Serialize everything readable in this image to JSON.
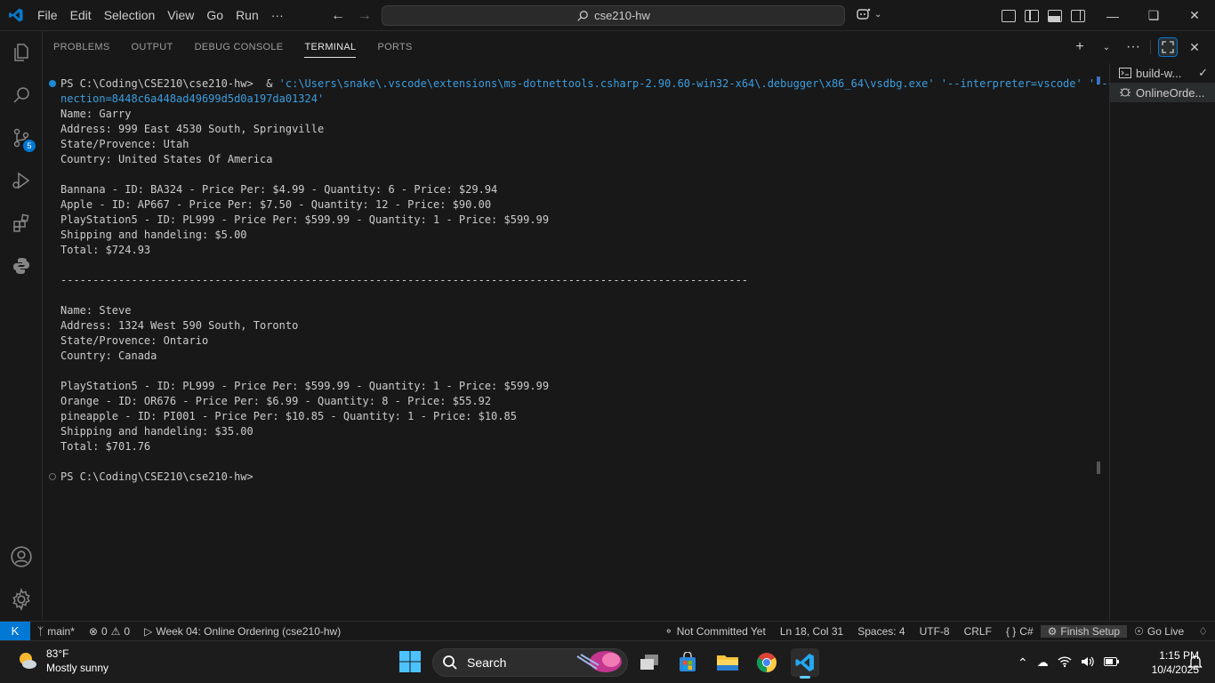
{
  "titlebar": {
    "menu": [
      "File",
      "Edit",
      "Selection",
      "View",
      "Go",
      "Run",
      "···"
    ],
    "search_text": "cse210-hw"
  },
  "panel": {
    "tabs": [
      "PROBLEMS",
      "OUTPUT",
      "DEBUG CONSOLE",
      "TERMINAL",
      "PORTS"
    ],
    "active_tab": "TERMINAL"
  },
  "terminal": {
    "command_prompt": "PS C:\\Coding\\CSE210\\cse210-hw>  & ",
    "command_string": "'c:\\Users\\snake\\.vscode\\extensions\\ms-dotnettools.csharp-2.90.60-win32-x64\\.debugger\\x86_64\\vsdbg.exe' '--interpreter=vscode' '--con",
    "command_wrap": "nection=8448c6a448ad49699d5d0a197da01324'",
    "lines": [
      "Name: Garry",
      "Address: 999 East 4530 South, Springville",
      "State/Provence: Utah",
      "Country: United States Of America",
      "",
      "Bannana - ID: BA324 - Price Per: $4.99 - Quantity: 6 - Price: $29.94",
      "Apple - ID: AP667 - Price Per: $7.50 - Quantity: 12 - Price: $90.00",
      "PlayStation5 - ID: PL999 - Price Per: $599.99 - Quantity: 1 - Price: $599.99",
      "Shipping and handeling: $5.00",
      "Total: $724.93",
      "",
      "-----------------------------------------------------------------------------------------------------------",
      "",
      "Name: Steve",
      "Address: 1324 West 590 South, Toronto",
      "State/Provence: Ontario",
      "Country: Canada",
      "",
      "PlayStation5 - ID: PL999 - Price Per: $599.99 - Quantity: 1 - Price: $599.99",
      "Orange - ID: OR676 - Price Per: $6.99 - Quantity: 8 - Price: $55.92",
      "pineapple - ID: PI001 - Price Per: $10.85 - Quantity: 1 - Price: $10.85",
      "Shipping and handeling: $35.00",
      "Total: $701.76",
      ""
    ],
    "final_prompt": "PS C:\\Coding\\CSE210\\cse210-hw>"
  },
  "terminal_list": {
    "items": [
      "build-w...",
      "OnlineOrde..."
    ]
  },
  "activity_bar": {
    "source_control_badge": "5"
  },
  "statusbar": {
    "branch": "main*",
    "errors": "0",
    "warnings": "0",
    "launch_config": "Week 04: Online Ordering (cse210-hw)",
    "blame": "Not Committed Yet",
    "cursor": "Ln 18, Col 31",
    "spaces": "Spaces: 4",
    "encoding": "UTF-8",
    "eol": "CRLF",
    "language": "C#",
    "finish_setup": "Finish Setup",
    "go_live": "Go Live"
  },
  "taskbar": {
    "temperature": "83°F",
    "weather": "Mostly sunny",
    "search_label": "Search",
    "time": "1:15 PM",
    "date": "10/4/2025"
  },
  "colors": {
    "accent": "#0078d4",
    "terminal_string": "#3b9ee0",
    "background": "#181818"
  }
}
